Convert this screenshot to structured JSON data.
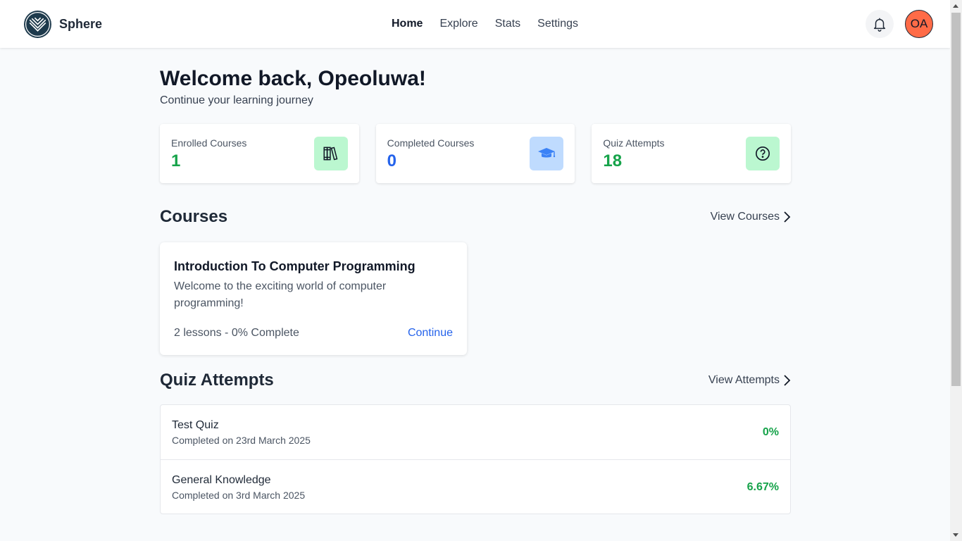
{
  "header": {
    "brand": "Sphere",
    "nav": [
      {
        "label": "Home",
        "active": true
      },
      {
        "label": "Explore",
        "active": false
      },
      {
        "label": "Stats",
        "active": false
      },
      {
        "label": "Settings",
        "active": false
      }
    ],
    "avatar_initials": "OA",
    "avatar_color": "#ff6b47"
  },
  "welcome": {
    "title": "Welcome back, Opeoluwa!",
    "subtitle": "Continue your learning journey"
  },
  "stats": [
    {
      "label": "Enrolled Courses",
      "value": "1",
      "color": "#16a34a",
      "icon": "books-icon",
      "icon_bg": "#bbf7d0"
    },
    {
      "label": "Completed Courses",
      "value": "0",
      "color": "#2563eb",
      "icon": "graduation-cap-icon",
      "icon_bg": "#bfdbfe"
    },
    {
      "label": "Quiz Attempts",
      "value": "18",
      "color": "#16a34a",
      "icon": "question-circle-icon",
      "icon_bg": "#bbf7d0"
    }
  ],
  "courses": {
    "title": "Courses",
    "link": "View Courses",
    "items": [
      {
        "title": "Introduction To Computer Programming",
        "description": "Welcome to the exciting world of computer programming!",
        "meta": "2 lessons - 0% Complete",
        "action": "Continue"
      }
    ]
  },
  "quiz_attempts": {
    "title": "Quiz Attempts",
    "link": "View Attempts",
    "items": [
      {
        "name": "Test Quiz",
        "date": "Completed on 23rd March 2025",
        "score": "0%"
      },
      {
        "name": "General Knowledge",
        "date": "Completed on 3rd March 2025",
        "score": "6.67%"
      }
    ]
  }
}
